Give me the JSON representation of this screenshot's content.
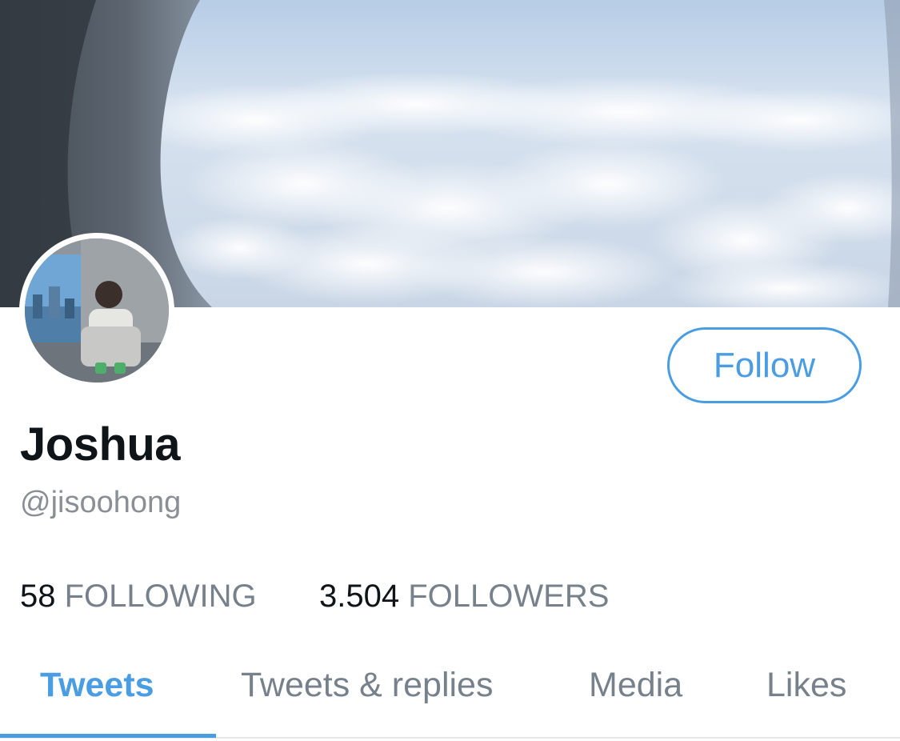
{
  "profile": {
    "display_name": "Joshua",
    "handle": "@jisoohong",
    "follow_label": "Follow"
  },
  "stats": {
    "following_count": "58",
    "following_label": "FOLLOWING",
    "followers_count": "3.504",
    "followers_label": "FOLLOWERS"
  },
  "tabs": [
    {
      "label": "Tweets",
      "active": true
    },
    {
      "label": "Tweets & replies",
      "active": false
    },
    {
      "label": "Media",
      "active": false
    },
    {
      "label": "Likes",
      "active": false
    }
  ],
  "colors": {
    "accent": "#4a9de3",
    "text_primary": "#0f1419",
    "text_secondary": "#76818c"
  }
}
